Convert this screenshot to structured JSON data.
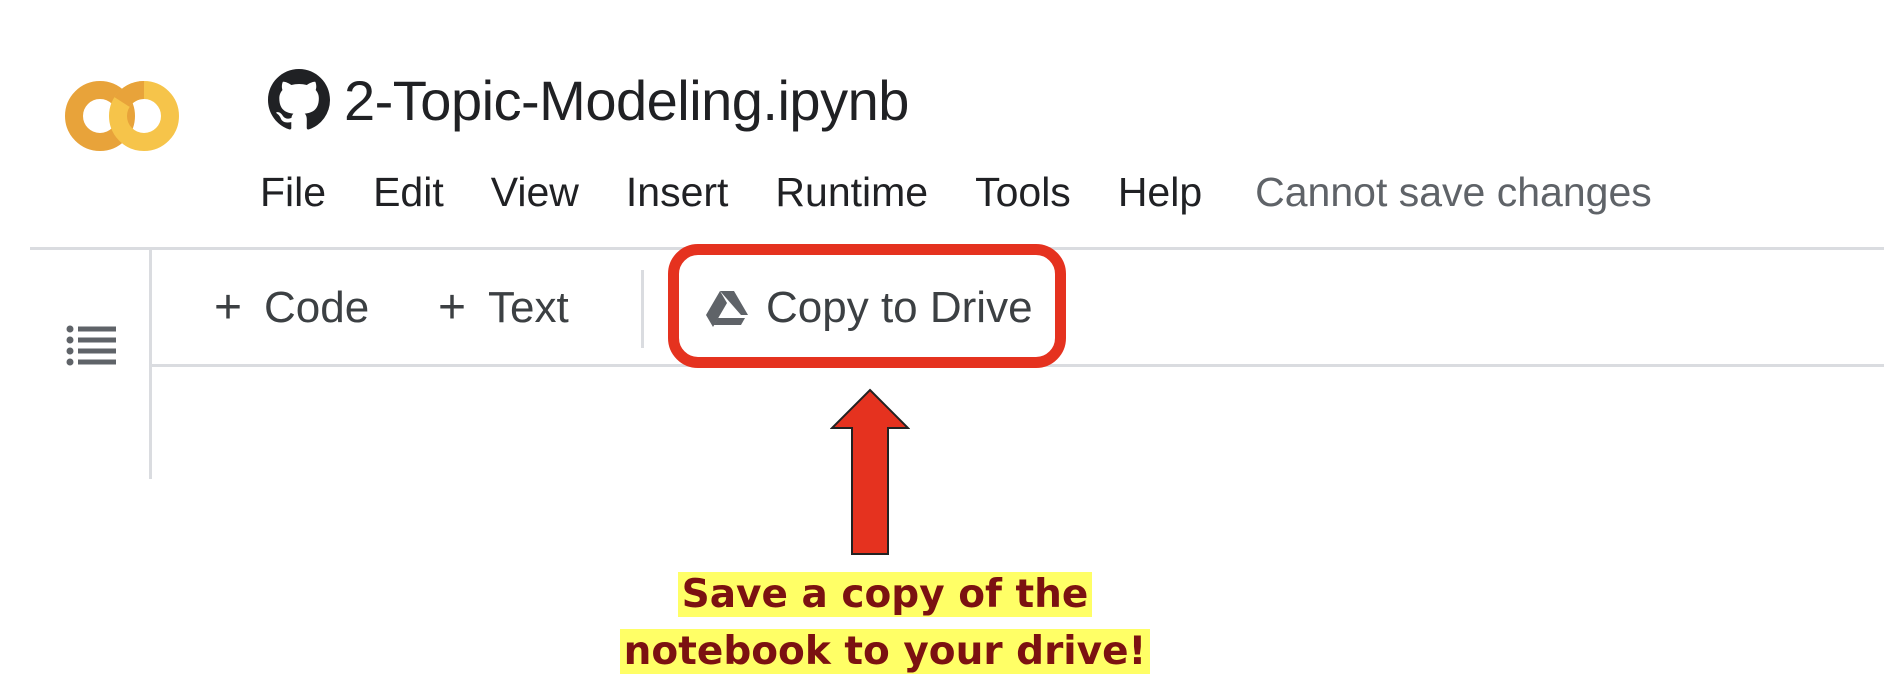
{
  "app": {
    "notebook_title": "2-Topic-Modeling.ipynb",
    "logo_icon": "colab-logo-icon",
    "title_icon": "github-icon"
  },
  "menu": {
    "items": [
      "File",
      "Edit",
      "View",
      "Insert",
      "Runtime",
      "Tools",
      "Help"
    ],
    "status": "Cannot save changes"
  },
  "sidebar": {
    "toc_icon": "table-of-contents-icon"
  },
  "toolbar": {
    "code_label": "Code",
    "text_label": "Text",
    "plus_symbol": "+",
    "copy_label": "Copy to Drive",
    "copy_icon": "google-drive-icon"
  },
  "annotation": {
    "line1": "Save a copy of the",
    "line2": "notebook to your drive!",
    "arrow_icon": "up-arrow-icon"
  },
  "colors": {
    "logo_orange": "#e8a33a",
    "logo_yellow": "#f6c44a",
    "highlight_red": "#e5321f",
    "annotation_text": "#7b1111",
    "annotation_bg": "#ffff66"
  }
}
